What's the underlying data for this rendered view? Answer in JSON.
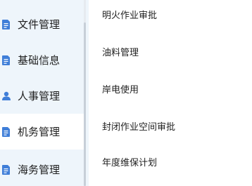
{
  "sidebar": {
    "items": [
      {
        "label": "文件管理",
        "icon": "document-icon"
      },
      {
        "label": "基础信息",
        "icon": "document-icon"
      },
      {
        "label": "人事管理",
        "icon": "person-icon"
      },
      {
        "label": "机务管理",
        "icon": "document-icon",
        "active": true
      },
      {
        "label": "海务管理",
        "icon": "document-icon"
      }
    ]
  },
  "submenu": {
    "items": [
      {
        "label": "明火作业审批"
      },
      {
        "label": "油料管理"
      },
      {
        "label": "岸电使用"
      },
      {
        "label": "封闭作业空间审批"
      },
      {
        "label": "年度维保计划"
      }
    ]
  },
  "colors": {
    "sidebar_bg": "#eef5fb",
    "active_bg": "#ffffff",
    "icon_blue": "#3f7ed8",
    "text": "#1f1f1f"
  }
}
